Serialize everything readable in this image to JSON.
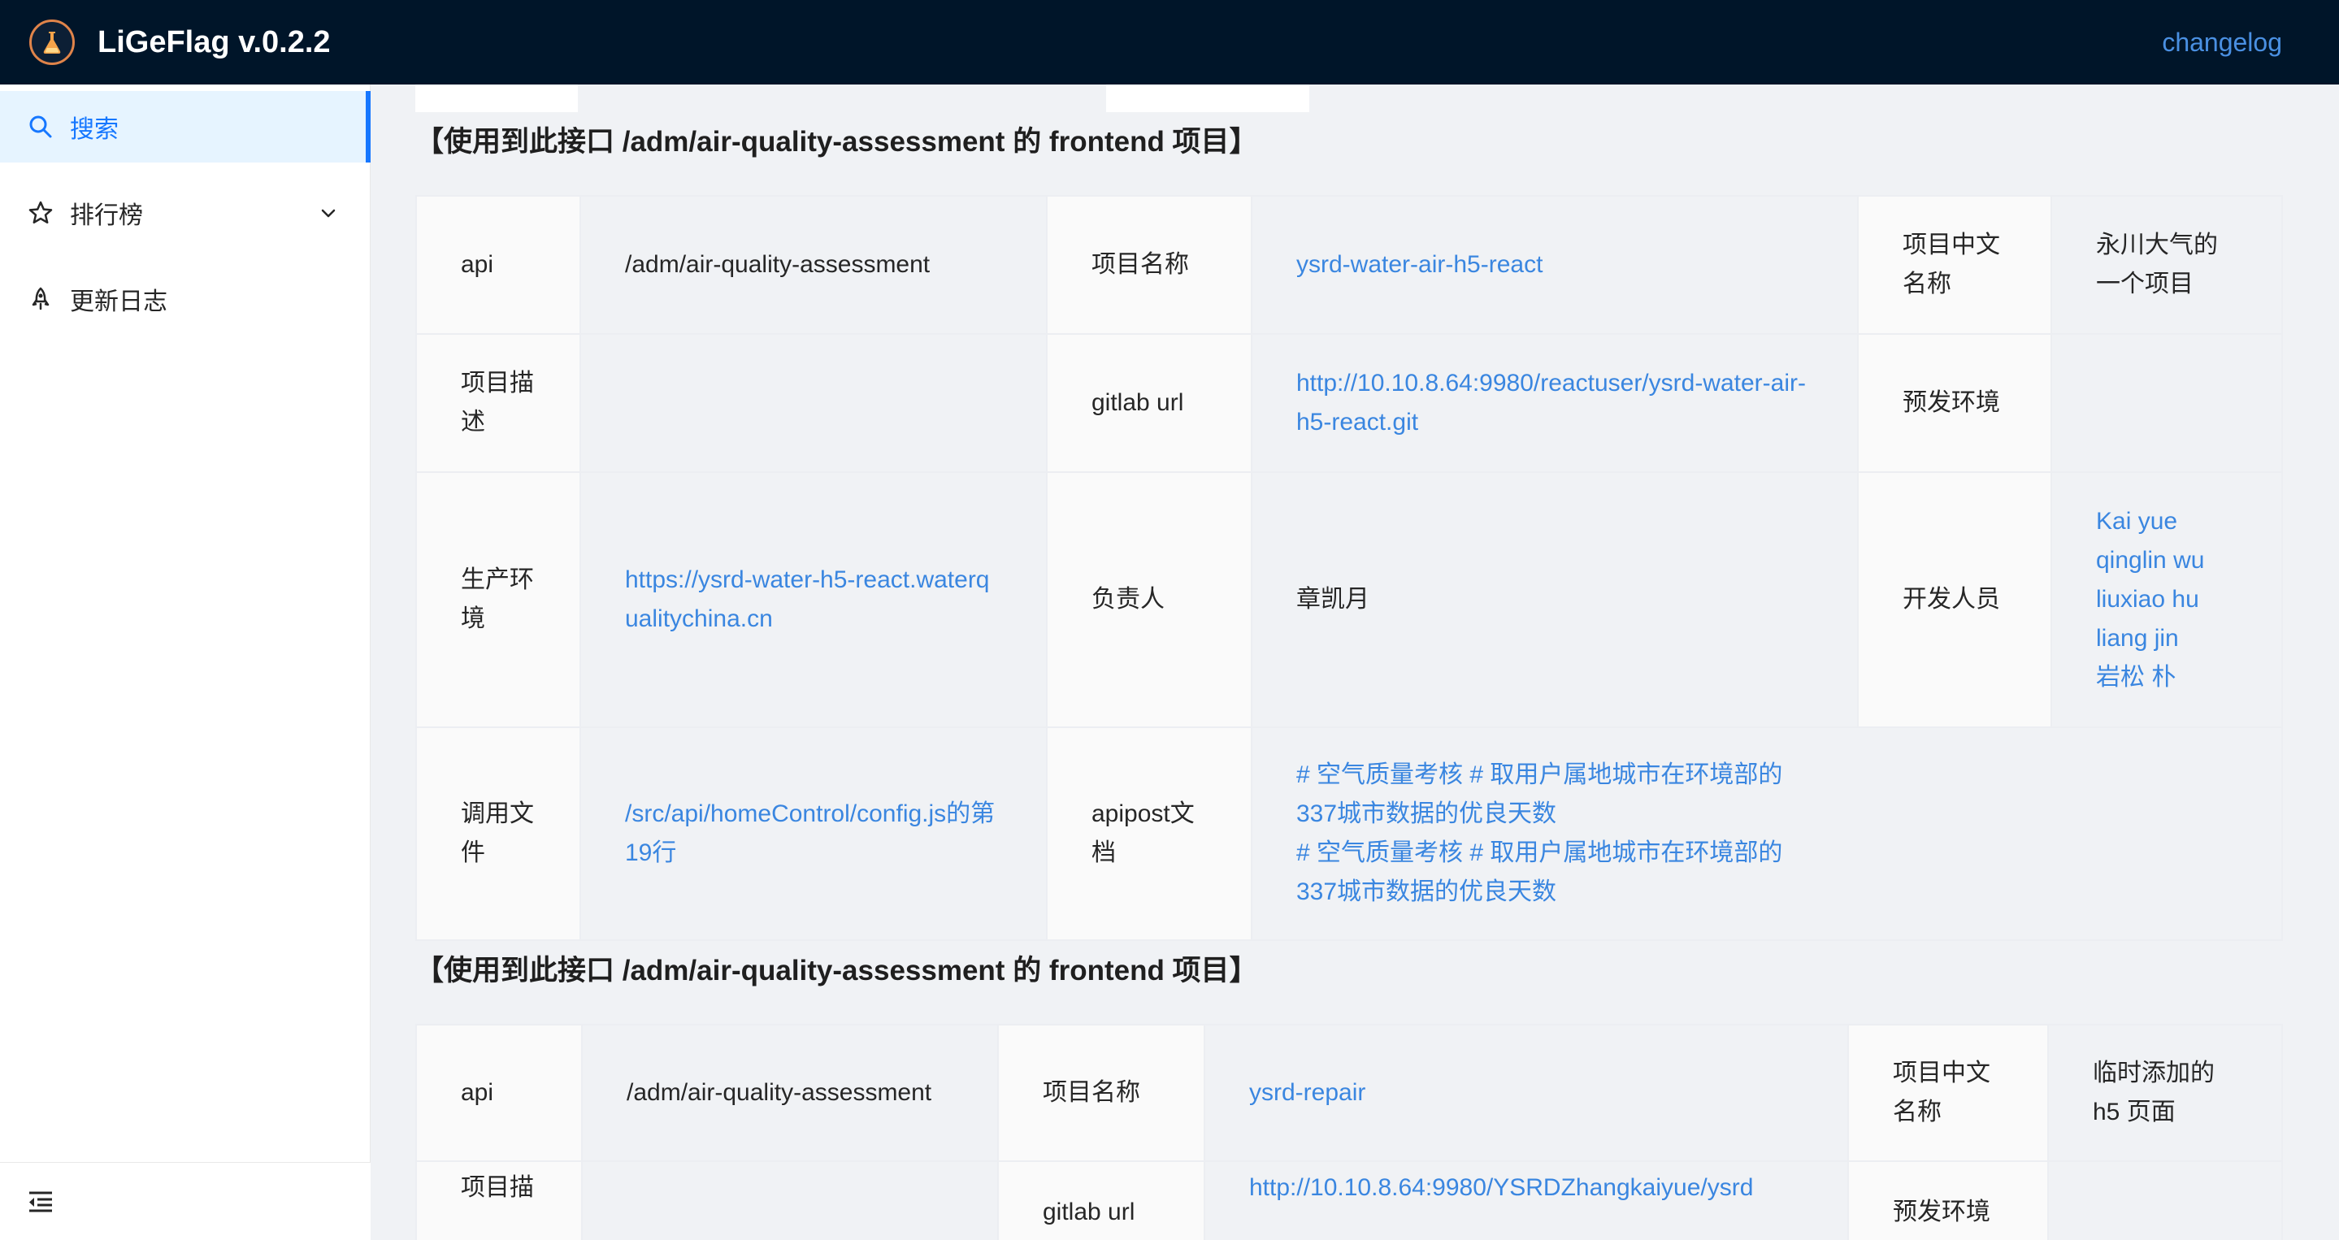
{
  "app": {
    "title": "LiGeFlag v.0.2.2",
    "changelog_label": "changelog",
    "logo_icon": "flask-logo-icon"
  },
  "sidebar": {
    "items": [
      {
        "label": "搜索",
        "icon": "search-icon",
        "active": true
      },
      {
        "label": "排行榜",
        "icon": "star-icon",
        "active": false
      },
      {
        "label": "更新日志",
        "icon": "rocket-icon",
        "active": false
      }
    ],
    "collapse_icon": "menu-fold-icon"
  },
  "colors": {
    "header_bg": "#001529",
    "accent": "#1677ff",
    "link": "#3a86e0"
  },
  "sections": [
    {
      "title": "【使用到此接口 /adm/air-quality-assessment 的 frontend 项目】",
      "fields": {
        "api_label": "api",
        "api_value": "/adm/air-quality-assessment",
        "name_label": "项目名称",
        "name_value": "ysrd-water-air-h5-react",
        "cn_name_label": "项目中文名称",
        "cn_name_value": "永川大气的一个项目",
        "desc_label": "项目描述",
        "desc_value": "",
        "gitlab_label": "gitlab url",
        "gitlab_value": "http://10.10.8.64:9980/reactuser/ysrd-water-air-h5-react.git",
        "pre_env_label": "预发环境",
        "pre_env_value": "",
        "prod_env_label": "生产环境",
        "prod_env_value": "https://ysrd-water-h5-react.waterqualitychina.cn",
        "owner_label": "负责人",
        "owner_value": "章凯月",
        "devs_label": "开发人员",
        "devs": [
          "Kai yue",
          "qinglin wu",
          "liuxiao hu",
          "liang jin",
          "岩松 朴"
        ],
        "call_file_label": "调用文件",
        "call_file_value": "/src/api/homeControl/config.js的第19行",
        "apipost_label": "apipost文档",
        "apipost_docs": [
          "# 空气质量考核 # 取用户属地城市在环境部的337城市数据的优良天数",
          "# 空气质量考核 # 取用户属地城市在环境部的337城市数据的优良天数"
        ]
      }
    },
    {
      "title": "【使用到此接口 /adm/air-quality-assessment 的 frontend 项目】",
      "fields": {
        "api_label": "api",
        "api_value": "/adm/air-quality-assessment",
        "name_label": "项目名称",
        "name_value": "ysrd-repair",
        "cn_name_label": "项目中文名称",
        "cn_name_value": "临时添加的h5 页面",
        "desc_label": "项目描",
        "gitlab_label": "gitlab url",
        "gitlab_value": "http://10.10.8.64:9980/YSRDZhangkaiyue/ysrd",
        "pre_env_label": "预发环境"
      }
    }
  ]
}
